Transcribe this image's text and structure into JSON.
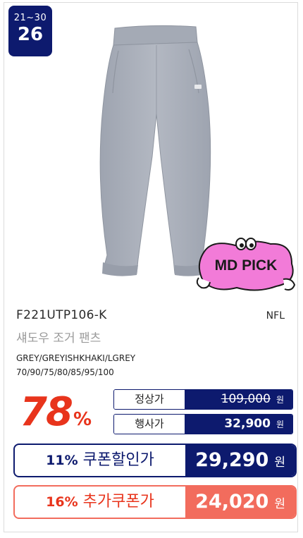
{
  "rank": {
    "range": "21~30",
    "number": "26"
  },
  "product": {
    "code": "F221UTP106-K",
    "brand": "NFL",
    "name": "섀도우 조거 팬츠",
    "colors": "GREY/GREYISHKHAKI/LGREY",
    "sizes": "70/90/75/80/85/95/100"
  },
  "badge": {
    "label": "MD PICK"
  },
  "discount": {
    "rate": "78",
    "unit": "%"
  },
  "prices": {
    "regular": {
      "label": "정상가",
      "value": "109,000",
      "unit": "원"
    },
    "event": {
      "label": "행사가",
      "value": "32,900",
      "unit": "원"
    }
  },
  "coupons": [
    {
      "rate": "11%",
      "label": "쿠폰할인가",
      "value": "29,290",
      "unit": "원"
    },
    {
      "rate": "16%",
      "label": "추가쿠폰가",
      "value": "24,020",
      "unit": "원"
    }
  ],
  "colors": {
    "navy": "#0d1a6e",
    "red": "#e8341c",
    "coral": "#f26c5d",
    "pink": "#f27bd8",
    "pants": "#a9afba"
  }
}
